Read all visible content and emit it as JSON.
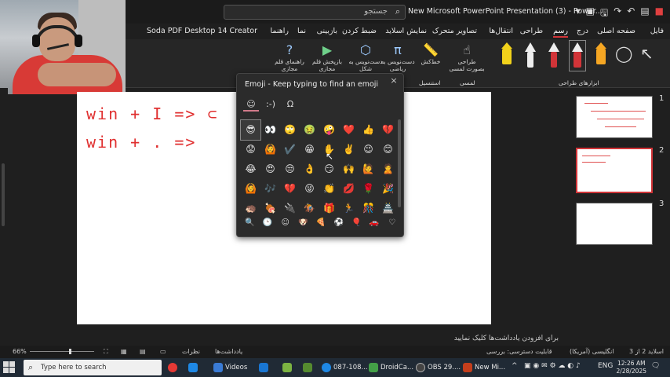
{
  "window": {
    "title": "New Microsoft PowerPoint Presentation (3) - Power...",
    "search_placeholder": "جستجو",
    "search_icon": "search-icon"
  },
  "tabs": [
    {
      "label": "فایل"
    },
    {
      "label": "صفحه اصلی"
    },
    {
      "label": "درج"
    },
    {
      "label": "رسم",
      "active": true
    },
    {
      "label": "طراحی"
    },
    {
      "label": "انتقال‌ها"
    },
    {
      "label": "تصاویر متحرک"
    },
    {
      "label": "نمایش اسلاید"
    },
    {
      "label": "ضبط کردن"
    },
    {
      "label": "بازبینی"
    },
    {
      "label": "نما"
    },
    {
      "label": "راهنما"
    },
    {
      "label": "Soda PDF Desktop 14 Creator"
    }
  ],
  "ribbon": {
    "buttons": [
      {
        "label": "راهنمای قلم مجازی",
        "icon": "help-icon"
      },
      {
        "label": "بازپخش قلم مجازی",
        "icon": "replay-icon"
      },
      {
        "label": "دست‌نویس به شکل",
        "icon": "ink-to-shape-icon"
      },
      {
        "label": "دست‌نویس به ریاضی",
        "icon": "ink-to-math-icon"
      },
      {
        "label": "خط‌کش",
        "icon": "ruler-icon"
      },
      {
        "label": "طراحی بصورت لمسی",
        "icon": "touch-draw-icon"
      }
    ],
    "groups": {
      "stencils": "استنسیل",
      "touch": "لمسی",
      "drawing_tools": "ابزارهای طراحی"
    },
    "pens": [
      {
        "color": "#f2d21b",
        "name": "highlighter-yellow"
      },
      {
        "color": "#eeeeee",
        "name": "pen-black"
      },
      {
        "color": "#d13438",
        "name": "pen-red"
      },
      {
        "color": "#d13438",
        "name": "pen-red-selected",
        "selected": true
      },
      {
        "color": "#f5a623",
        "name": "highlighter-orange"
      }
    ]
  },
  "slide": {
    "line1": "win + I => ⊂",
    "line2": "win + . =>"
  },
  "emoji_panel": {
    "title": "Emoji - Keep typing to find an emoji",
    "close_icon": "×",
    "categories": [
      "☺",
      ":-)",
      "Ω"
    ],
    "emojis": [
      "😎",
      "👀",
      "🙄",
      "🤢",
      "🤪",
      "❤️",
      "👍",
      "💔",
      "😟",
      "🙆",
      "✔️",
      "😁",
      "✋",
      "✌️",
      "😉",
      "😊",
      "😂",
      "😍",
      "😒",
      "👌",
      "😏",
      "🙌",
      "🙋",
      "🙎",
      "🙆",
      "🎶",
      "💔",
      "😜",
      "👏",
      "💋",
      "🌹",
      "🎉",
      "🦔",
      "🍖",
      "🔌",
      "🏇",
      "🎁",
      "🏃",
      "🎊",
      "🏯"
    ],
    "bottom_categories": [
      "🔍",
      "🕒",
      "☺",
      "🐶",
      "🍕",
      "⚽",
      "🎈",
      "🚗",
      "♡"
    ]
  },
  "thumbnails": [
    {
      "number": "1"
    },
    {
      "number": "2",
      "active": true
    },
    {
      "number": "3"
    }
  ],
  "notes": {
    "placeholder": "برای افزودن یادداشت‌ها کلیک نمایید"
  },
  "status": {
    "zoom": "66%",
    "slide_info": "اسلاید 2 از 3",
    "language": "انگلیسی (آمریکا)",
    "accessibility": "قابلیت دسترسی: بررسی",
    "notes_label": "یادداشت‌ها",
    "comments_label": "نظرات"
  },
  "taskbar": {
    "search_placeholder": "Type here to search",
    "apps": [
      {
        "label": "Videos",
        "color": "#3a7bd5"
      },
      {
        "label": "087-108...",
        "color": "#1e88e5"
      },
      {
        "label": "DroidCa...",
        "color": "#43a047"
      },
      {
        "label": "OBS 29....",
        "color": "#444444"
      },
      {
        "label": "New Mi...",
        "color": "#c43e1c"
      }
    ],
    "language": "ENG",
    "time": "12:26 AM",
    "date": "2/28/2025"
  }
}
